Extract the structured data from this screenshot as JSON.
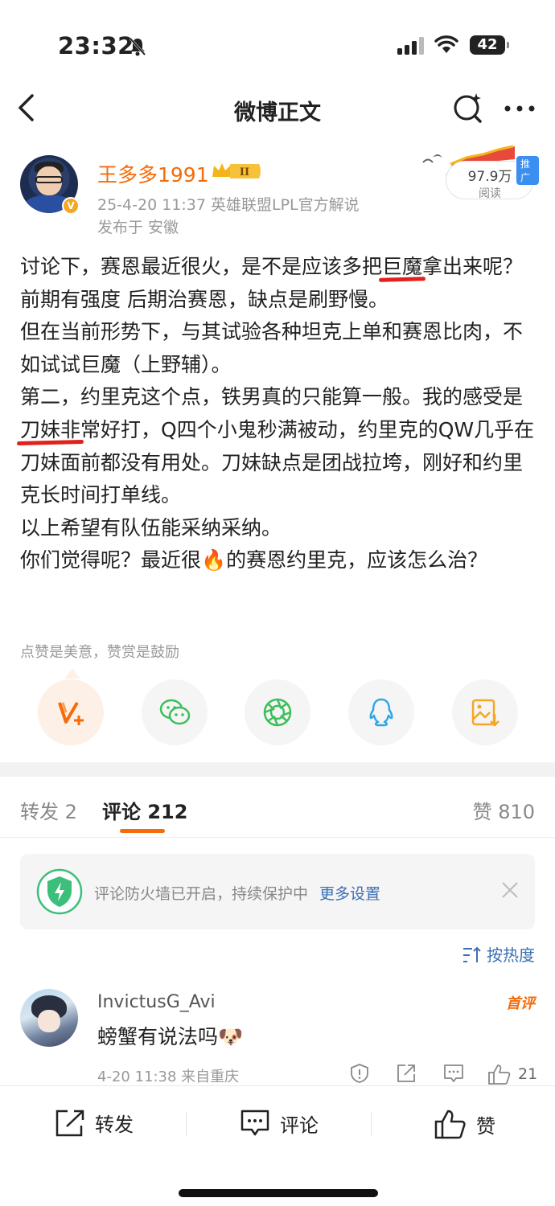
{
  "status_bar": {
    "time": "23:32",
    "battery": "42"
  },
  "nav": {
    "title": "微博正文"
  },
  "author": {
    "name": "王多多1991",
    "level_badge": "II",
    "time_source": "25-4-20 11:37  英雄联盟LPL官方解说",
    "location": "发布于 安徽",
    "reads": "97.9万",
    "reads_label": "阅读",
    "promo": "推广"
  },
  "post": {
    "lines": [
      [
        "讨论下，赛恩最近很火，是不是应该多把",
        "巨魔",
        "拿出来呢？前期有强度 后期治赛恩，缺点是刷野慢。"
      ],
      [
        "但在当前形势下，与其试验各种坦克上单和赛恩比肉，不如试试巨魔（上野辅）。"
      ],
      [
        "第二，约里克这个点，铁男真的只能算一般。我的感受是",
        "刀妹非",
        "常好打，Q四个小鬼秒满被动，约里克的QW几乎在刀妹面前都没有用处。刀妹缺点是团战拉垮，刚好和约里克长时间打单线。"
      ],
      [
        "以上希望有队伍能采纳采纳。"
      ],
      [
        "你们觉得呢？最近很",
        "🔥",
        "的赛恩约里克，应该怎么治？"
      ]
    ]
  },
  "tip": "点赞是美意，赞赏是鼓励",
  "share_icons": [
    "reward-icon",
    "wechat-icon",
    "moments-icon",
    "qq-icon",
    "save-image-icon"
  ],
  "tabs": {
    "repost": "转发 2",
    "comments": "评论 212",
    "likes": "赞 810"
  },
  "firewall": {
    "text": "评论防火墙已开启，持续保护中",
    "link": "更多设置"
  },
  "sort": "按热度",
  "comment": {
    "name": "InvictusG_Avi",
    "badge": "首评",
    "text": "螃蟹有说法吗",
    "emoji": "🐶",
    "meta": "4-20 11:38  来自重庆",
    "likes": "21"
  },
  "bottom": {
    "repost": "转发",
    "comment": "评论",
    "like": "赞"
  },
  "colors": {
    "accent": "#f56b0a",
    "link": "#3a6fb5",
    "mark": "#e0221f"
  }
}
